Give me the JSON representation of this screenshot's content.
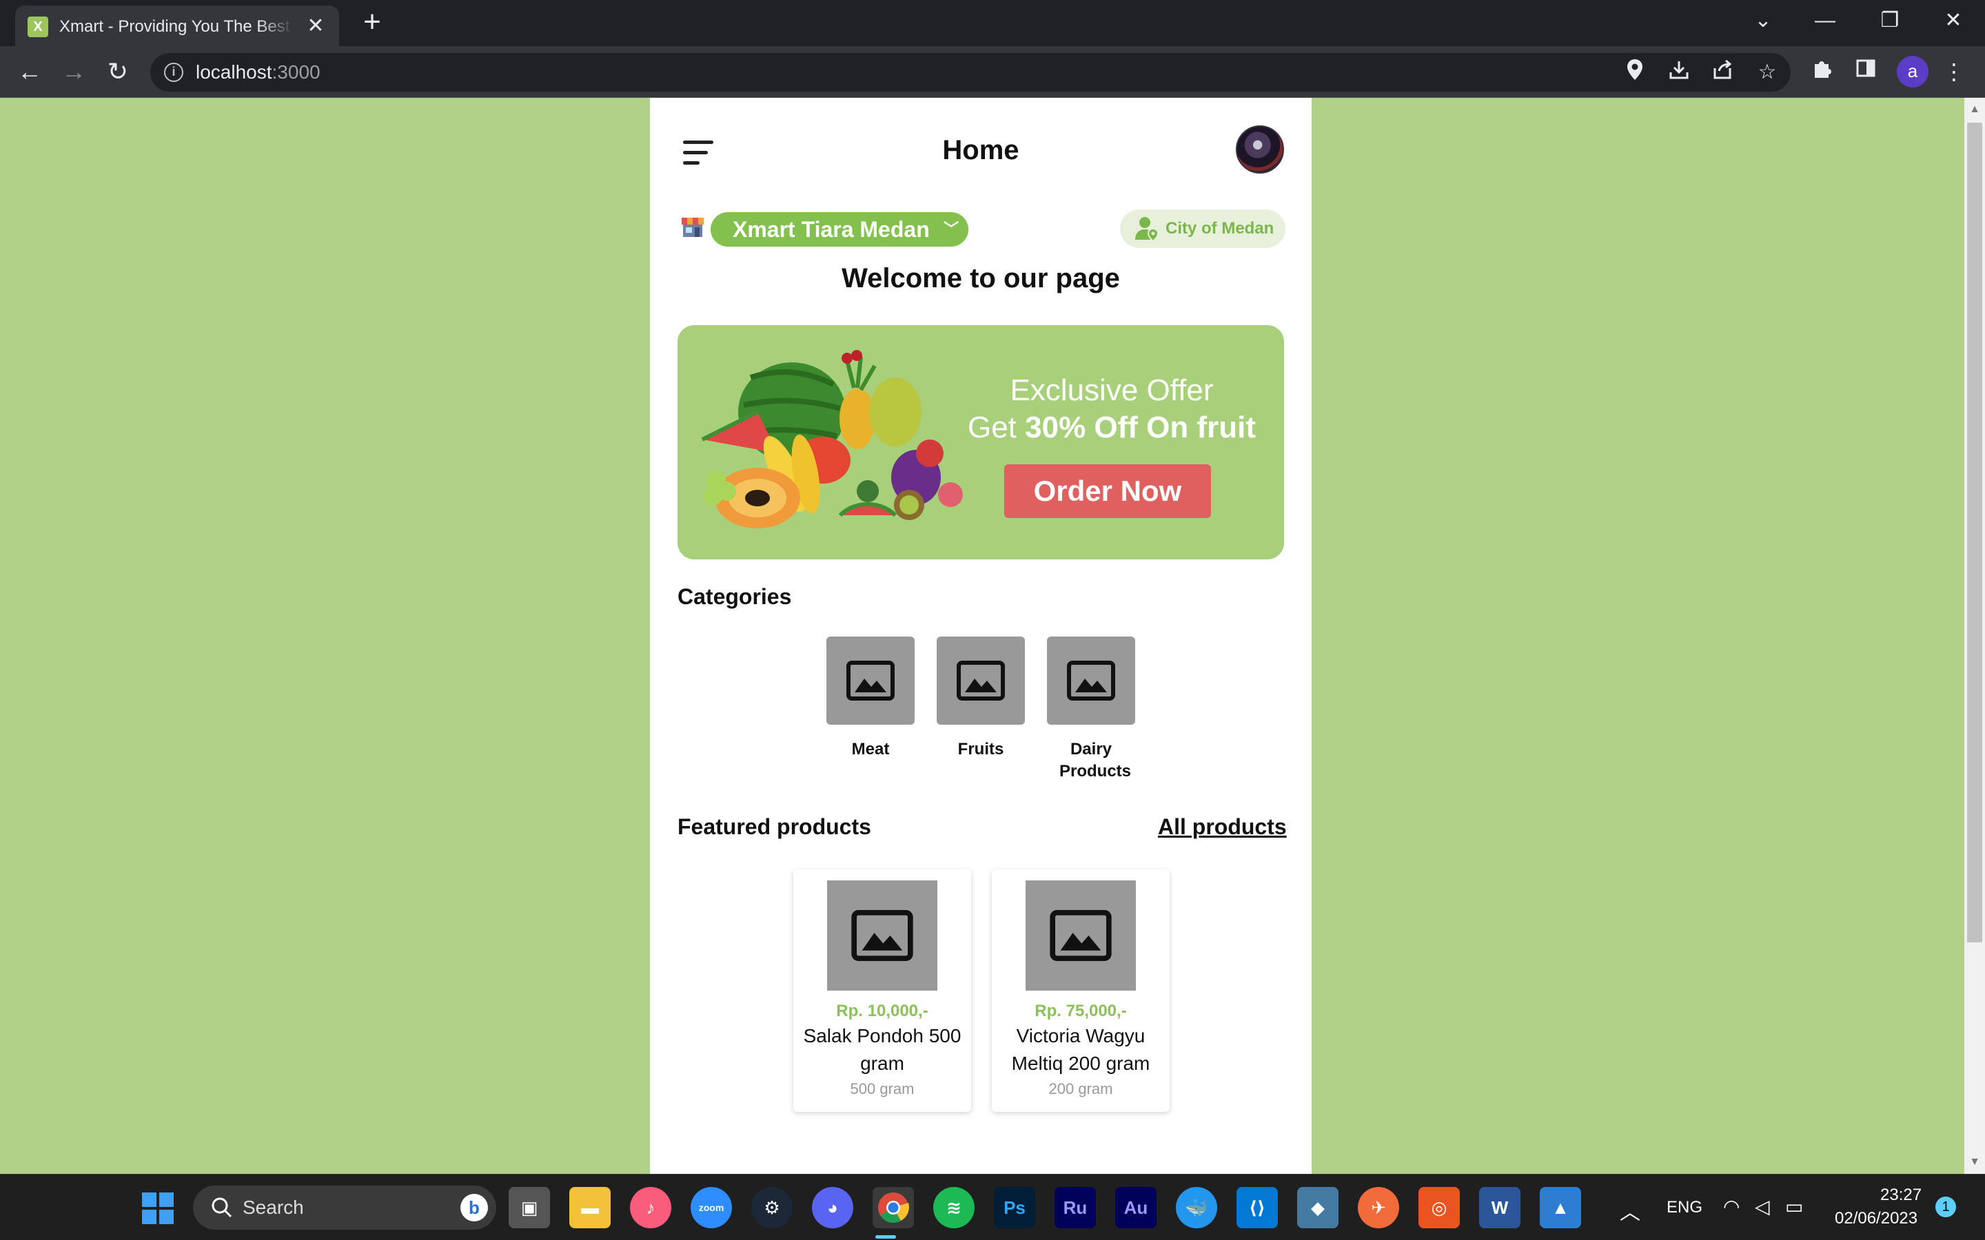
{
  "browser": {
    "tab_title": "Xmart - Providing You The Best G",
    "favicon_letter": "X",
    "url_host": "localhost",
    "url_port": ":3000",
    "profile_initial": "a"
  },
  "app": {
    "title": "Home",
    "store_name": "Xmart Tiara Medan",
    "city": "City of Medan",
    "welcome": "Welcome to our page",
    "banner": {
      "line1": "Exclusive Offer",
      "line2_prefix": "Get",
      "line2_bold": "30% Off On fruit",
      "cta": "Order Now"
    },
    "categories_title": "Categories",
    "categories": [
      {
        "label": "Meat"
      },
      {
        "label": "Fruits"
      },
      {
        "label": "Dairy Products"
      }
    ],
    "featured_title": "Featured products",
    "all_products_link": "All products",
    "products": [
      {
        "price": "Rp. 10,000,-",
        "name": "Salak Pondoh 500 gram",
        "weight": "500 gram"
      },
      {
        "price": "Rp. 75,000,-",
        "name": "Victoria Wagyu Meltiq 200 gram",
        "weight": "200 gram"
      }
    ]
  },
  "taskbar": {
    "search_label": "Search",
    "language": "ENG",
    "time": "23:27",
    "date": "02/06/2023",
    "notification_count": "1"
  },
  "colors": {
    "page_bg": "#b1d188",
    "accent_green": "#83c04d",
    "banner_bg": "#a8d07a",
    "cta_red": "#e06060",
    "price_green": "#8bc05a"
  }
}
